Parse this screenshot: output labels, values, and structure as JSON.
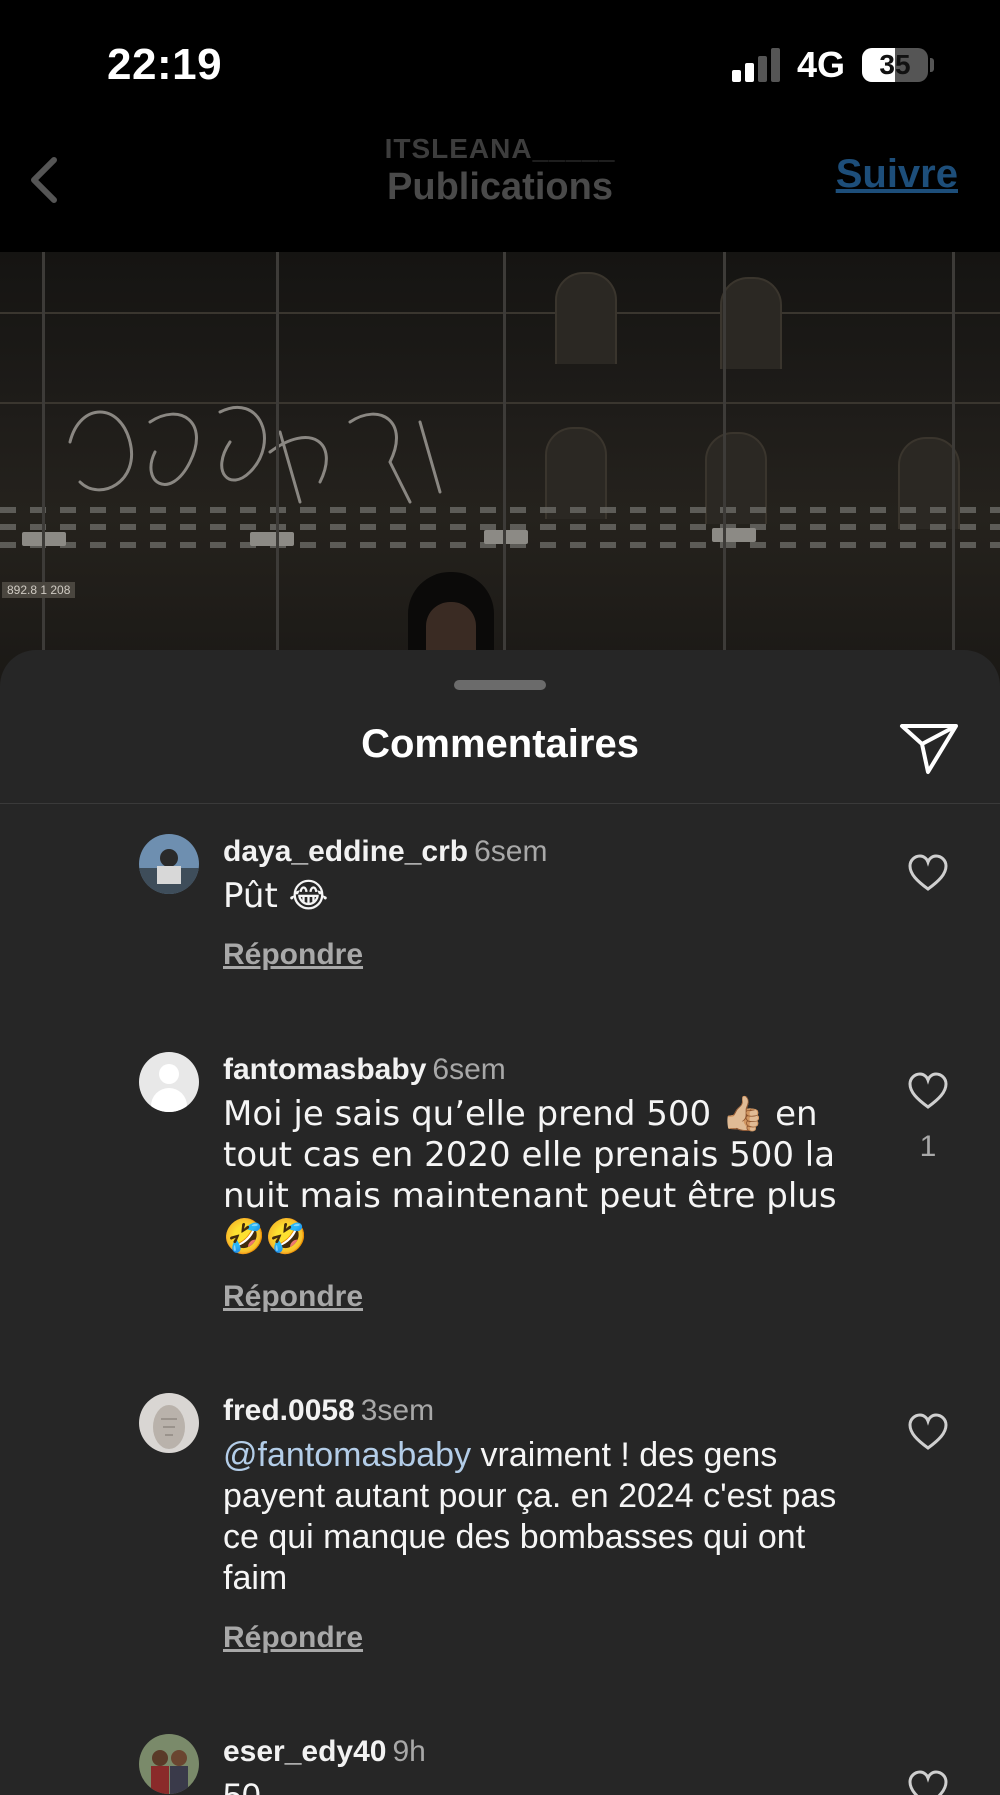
{
  "status_bar": {
    "time": "22:19",
    "network": "4G",
    "battery": "35"
  },
  "header": {
    "username": "ITSLEANA_____",
    "title": "Publications",
    "follow": "Suivre"
  },
  "post_image": {
    "plaque_text": "892.8 1 208"
  },
  "comments_sheet": {
    "title": "Commentaires"
  },
  "comments": [
    {
      "username": "daya_eddine_crb",
      "time": "6sem",
      "text": "Pût 😂",
      "reply": "Répondre",
      "likes": ""
    },
    {
      "username": "fantomasbaby",
      "time": "6sem",
      "text": "Moi je sais qu’elle prend 500 👍🏼 en tout cas en 2020 elle prenais 500 la nuit mais maintenant peut être plus 🤣🤣",
      "reply": "Répondre",
      "likes": "1"
    },
    {
      "username": "fred.0058",
      "time": "3sem",
      "mention": "@fantomasbaby",
      "text": " vraiment ! des gens payent autant pour ça. en 2024 c'est pas ce qui manque des bombasses qui ont faim",
      "reply": "Répondre",
      "likes": ""
    },
    {
      "username": "eser_edy40",
      "time": "9h",
      "text": "50",
      "reply": "",
      "likes": ""
    }
  ]
}
